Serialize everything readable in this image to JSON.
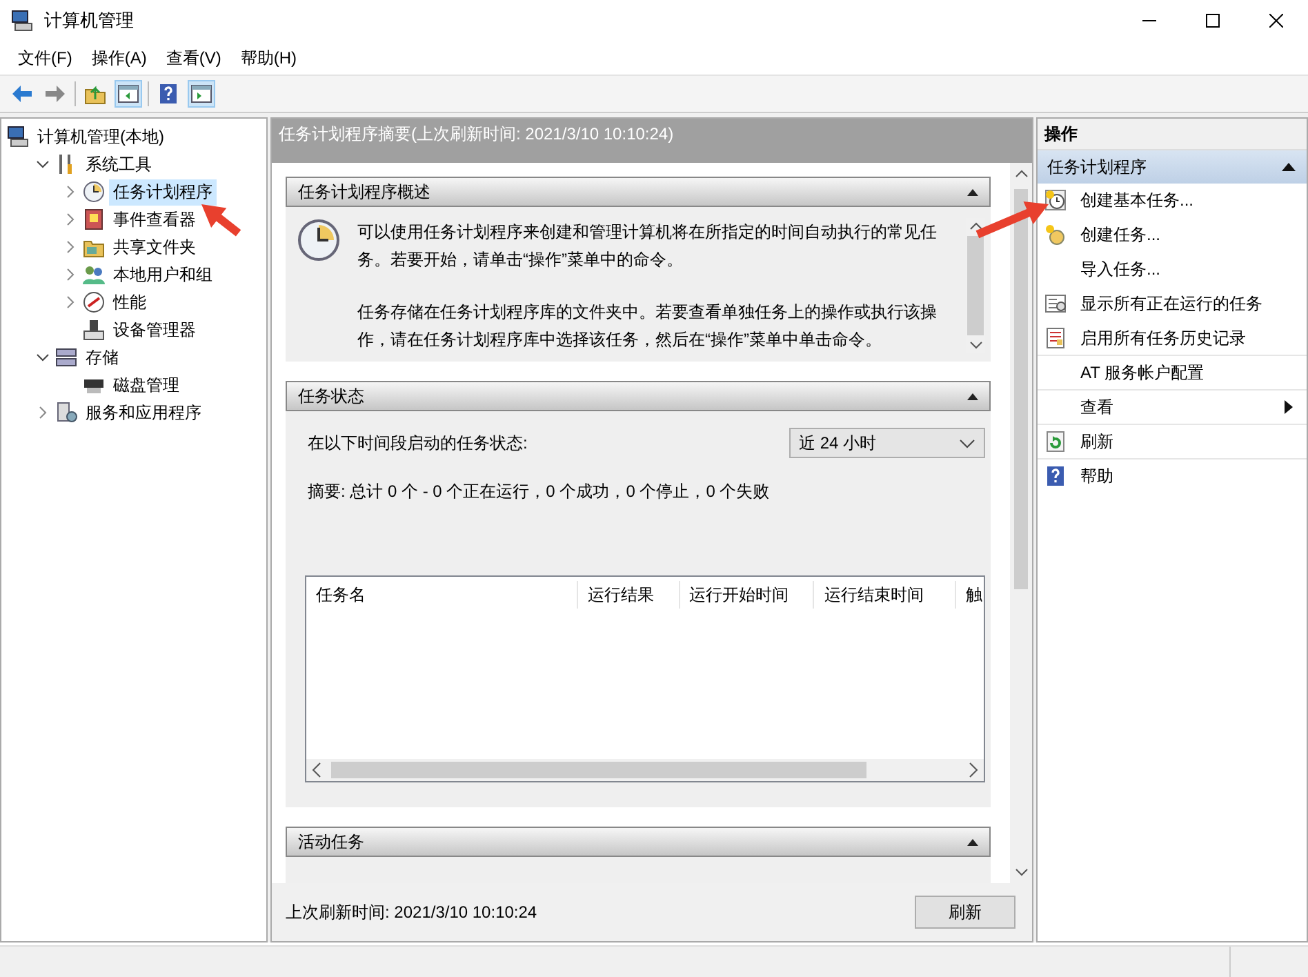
{
  "window": {
    "title": "计算机管理"
  },
  "menu": [
    "文件(F)",
    "操作(A)",
    "查看(V)",
    "帮助(H)"
  ],
  "tree": [
    {
      "label": "计算机管理(本地)",
      "selected": false,
      "children": [
        {
          "label": "系统工具",
          "expanded": true,
          "selected": false,
          "children": [
            {
              "label": "任务计划程序",
              "expanded": false,
              "selected": true
            },
            {
              "label": "事件查看器",
              "expanded": false,
              "selected": false
            },
            {
              "label": "共享文件夹",
              "expanded": false,
              "selected": false
            },
            {
              "label": "本地用户和组",
              "expanded": false,
              "selected": false
            },
            {
              "label": "性能",
              "expanded": false,
              "selected": false
            },
            {
              "label": "设备管理器",
              "selected": false
            }
          ]
        },
        {
          "label": "存储",
          "expanded": true,
          "selected": false,
          "children": [
            {
              "label": "磁盘管理",
              "selected": false
            }
          ]
        },
        {
          "label": "服务和应用程序",
          "expanded": false,
          "selected": false
        }
      ]
    }
  ],
  "summary": {
    "header": "任务计划程序摘要(上次刷新时间: 2021/3/10 10:10:24)",
    "sections": [
      {
        "kind": "overview",
        "title": "任务计划程序概述",
        "expanded": true,
        "paragraphs": [
          "可以使用任务计划程序来创建和管理计算机将在所指定的时间自动执行的常见任务。若要开始，请单击“操作”菜单中的命令。",
          "任务存储在任务计划程序库的文件夹中。若要查看单独任务上的操作或执行该操作，请在任务计划程序库中选择该任务，然后在“操作”菜单中单击命令。"
        ]
      },
      {
        "kind": "status",
        "title": "任务状态",
        "expanded": true,
        "period_label": "在以下时间段启动的任务状态:",
        "period": "近 24 小时",
        "summary": "摘要: 总计 0 个 - 0 个正在运行，0 个成功，0 个停止，0 个失败",
        "columns": [
          "任务名",
          "运行结果",
          "运行开始时间",
          "运行结束时间",
          "触"
        ]
      },
      {
        "kind": "active",
        "title": "活动任务",
        "expanded": true
      }
    ],
    "last_refresh": "上次刷新时间: 2021/3/10 10:10:24",
    "refresh_button": "刷新"
  },
  "actions": {
    "title": "操作",
    "group": {
      "title": "任务计划程序",
      "expanded": true
    },
    "items": [
      {
        "label": "创建基本任务...",
        "kind": "action"
      },
      {
        "label": "创建任务...",
        "kind": "action"
      },
      {
        "label": "导入任务...",
        "kind": "action"
      },
      {
        "label": "显示所有正在运行的任务",
        "kind": "action"
      },
      {
        "label": "启用所有任务历史记录",
        "kind": "action"
      },
      {
        "label": "AT 服务帐户配置",
        "kind": "action"
      },
      {
        "label": "查看",
        "kind": "submenu"
      },
      {
        "label": "刷新",
        "kind": "action"
      },
      {
        "label": "帮助",
        "kind": "action"
      }
    ]
  }
}
